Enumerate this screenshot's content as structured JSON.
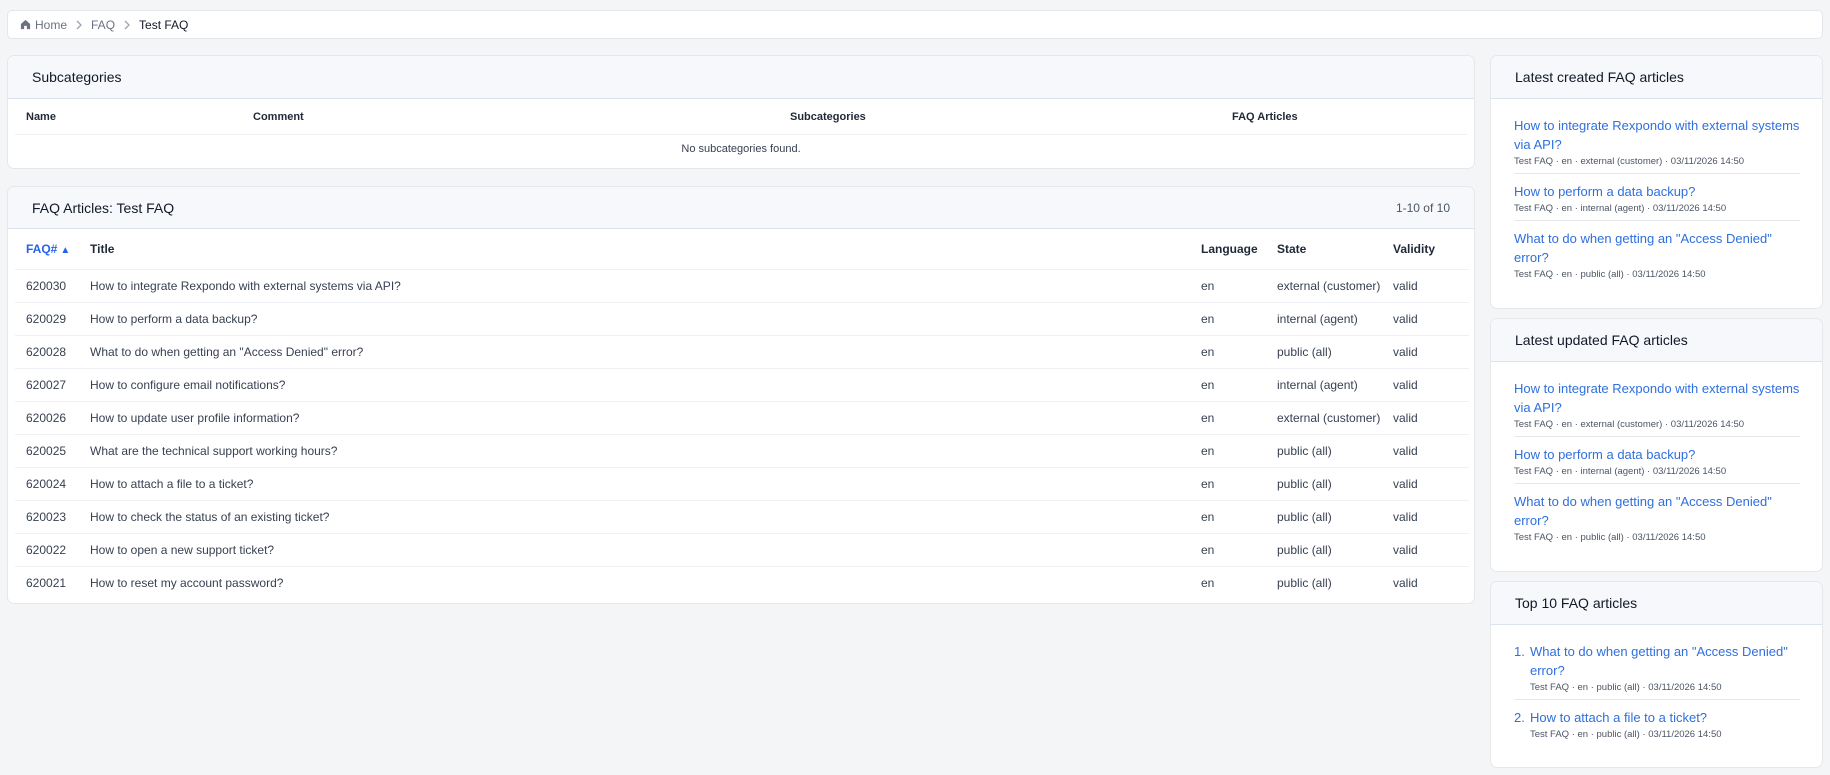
{
  "breadcrumb": {
    "home": "Home",
    "faq": "FAQ",
    "current": "Test FAQ"
  },
  "subcategories": {
    "title": "Subcategories",
    "columns": [
      "Name",
      "Comment",
      "Subcategories",
      "FAQ Articles"
    ],
    "empty": "No subcategories found."
  },
  "articles": {
    "title": "FAQ Articles: Test FAQ",
    "count": "1-10 of 10",
    "columns": {
      "id": "FAQ#",
      "sort_arrow": "▲",
      "title": "Title",
      "language": "Language",
      "state": "State",
      "validity": "Validity"
    },
    "rows": [
      {
        "id": "620030",
        "title": "How to integrate Rexpondo with external systems via API?",
        "language": "en",
        "state": "external (customer)",
        "validity": "valid"
      },
      {
        "id": "620029",
        "title": "How to perform a data backup?",
        "language": "en",
        "state": "internal (agent)",
        "validity": "valid"
      },
      {
        "id": "620028",
        "title": "What to do when getting an \"Access Denied\" error?",
        "language": "en",
        "state": "public (all)",
        "validity": "valid"
      },
      {
        "id": "620027",
        "title": "How to configure email notifications?",
        "language": "en",
        "state": "internal (agent)",
        "validity": "valid"
      },
      {
        "id": "620026",
        "title": "How to update user profile information?",
        "language": "en",
        "state": "external (customer)",
        "validity": "valid"
      },
      {
        "id": "620025",
        "title": "What are the technical support working hours?",
        "language": "en",
        "state": "public (all)",
        "validity": "valid"
      },
      {
        "id": "620024",
        "title": "How to attach a file to a ticket?",
        "language": "en",
        "state": "public (all)",
        "validity": "valid"
      },
      {
        "id": "620023",
        "title": "How to check the status of an existing ticket?",
        "language": "en",
        "state": "public (all)",
        "validity": "valid"
      },
      {
        "id": "620022",
        "title": "How to open a new support ticket?",
        "language": "en",
        "state": "public (all)",
        "validity": "valid"
      },
      {
        "id": "620021",
        "title": "How to reset my account password?",
        "language": "en",
        "state": "public (all)",
        "validity": "valid"
      }
    ]
  },
  "latest_created": {
    "title": "Latest created FAQ articles",
    "items": [
      {
        "link": "How to integrate Rexpondo with external systems via API?",
        "meta": "Test FAQ · en · external (customer) · 03/11/2026 14:50"
      },
      {
        "link": "How to perform a data backup?",
        "meta": "Test FAQ · en · internal (agent) · 03/11/2026 14:50"
      },
      {
        "link": "What to do when getting an \"Access Denied\" error?",
        "meta": "Test FAQ · en · public (all) · 03/11/2026 14:50"
      }
    ]
  },
  "latest_updated": {
    "title": "Latest updated FAQ articles",
    "items": [
      {
        "link": "How to integrate Rexpondo with external systems via API?",
        "meta": "Test FAQ · en · external (customer) · 03/11/2026 14:50"
      },
      {
        "link": "How to perform a data backup?",
        "meta": "Test FAQ · en · internal (agent) · 03/11/2026 14:50"
      },
      {
        "link": "What to do when getting an \"Access Denied\" error?",
        "meta": "Test FAQ · en · public (all) · 03/11/2026 14:50"
      }
    ]
  },
  "top10": {
    "title": "Top 10 FAQ articles",
    "items": [
      {
        "num": "1.",
        "link": "What to do when getting an \"Access Denied\" error?",
        "meta": "Test FAQ · en · public (all) · 03/11/2026 14:50"
      },
      {
        "num": "2.",
        "link": "How to attach a file to a ticket?",
        "meta": "Test FAQ · en · public (all) · 03/11/2026 14:50"
      }
    ]
  },
  "colors": {
    "link": "#2f6fde",
    "sort_header": "#2563eb",
    "header_bg": "#f6f8fb",
    "page_bg": "#f4f5f7"
  }
}
